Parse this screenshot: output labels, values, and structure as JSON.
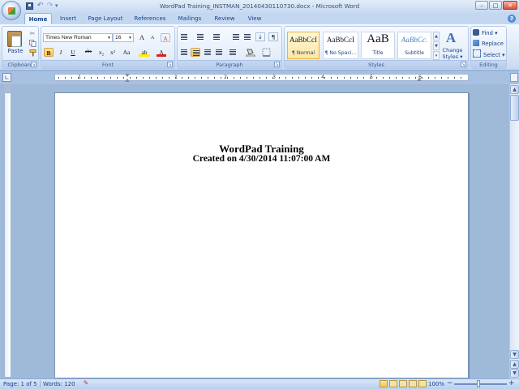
{
  "window": {
    "title": "WordPad Training_INSTMAN_20140430110730.docx - Microsoft Word",
    "minimize": "–",
    "maximize": "□",
    "close": "✕"
  },
  "quick_access": {
    "undo": "↶",
    "redo": "↷",
    "more": "▾"
  },
  "tabs": [
    {
      "label": "Home",
      "active": true
    },
    {
      "label": "Insert"
    },
    {
      "label": "Page Layout"
    },
    {
      "label": "References"
    },
    {
      "label": "Mailings"
    },
    {
      "label": "Review"
    },
    {
      "label": "View"
    }
  ],
  "help": "?",
  "ribbon": {
    "clipboard": {
      "label": "Clipboard",
      "paste": "Paste",
      "cut_icon": "✂"
    },
    "font": {
      "label": "Font",
      "font_name": "Times New Roman",
      "font_size": "16",
      "grow": "A",
      "shrink": "A",
      "clear": "A",
      "bold": "B",
      "italic": "I",
      "underline": "U",
      "strike": "abc",
      "subscript": "x₂",
      "superscript": "x²",
      "change_case": "Aa",
      "highlight": "ab",
      "font_color": "A"
    },
    "paragraph": {
      "label": "Paragraph",
      "show_marks": "¶",
      "sort": "↓"
    },
    "styles": {
      "label": "Styles",
      "items": [
        {
          "sample": "AaBbCcI",
          "name": "¶ Normal"
        },
        {
          "sample": "AaBbCcI",
          "name": "¶ No Spaci..."
        },
        {
          "sample": "AaB",
          "name": "Title"
        },
        {
          "sample": "AaBbCc.",
          "name": "Subtitle"
        }
      ],
      "change_styles_icon": "A",
      "change_styles": "Change Styles ▾"
    },
    "editing": {
      "label": "Editing",
      "find": "Find ▾",
      "replace": "Replace",
      "select": "Select ▾"
    }
  },
  "ruler": {
    "numbers": [
      "1",
      "1",
      "2",
      "3",
      "4",
      "5",
      "6"
    ]
  },
  "document": {
    "heading": "WordPad Training",
    "subheading": "Created on 4/30/2014 11:07:00 AM"
  },
  "statusbar": {
    "page": "Page: 1 of 5",
    "words": "Words: 120",
    "zoom": "100%",
    "zoom_minus": "−",
    "zoom_plus": "+"
  },
  "colors": {
    "ribbon_bg": "#dbe7f6",
    "accent_selected": "#ffc655",
    "workspace": "#9fb9d9",
    "text_blue": "#15428b"
  }
}
